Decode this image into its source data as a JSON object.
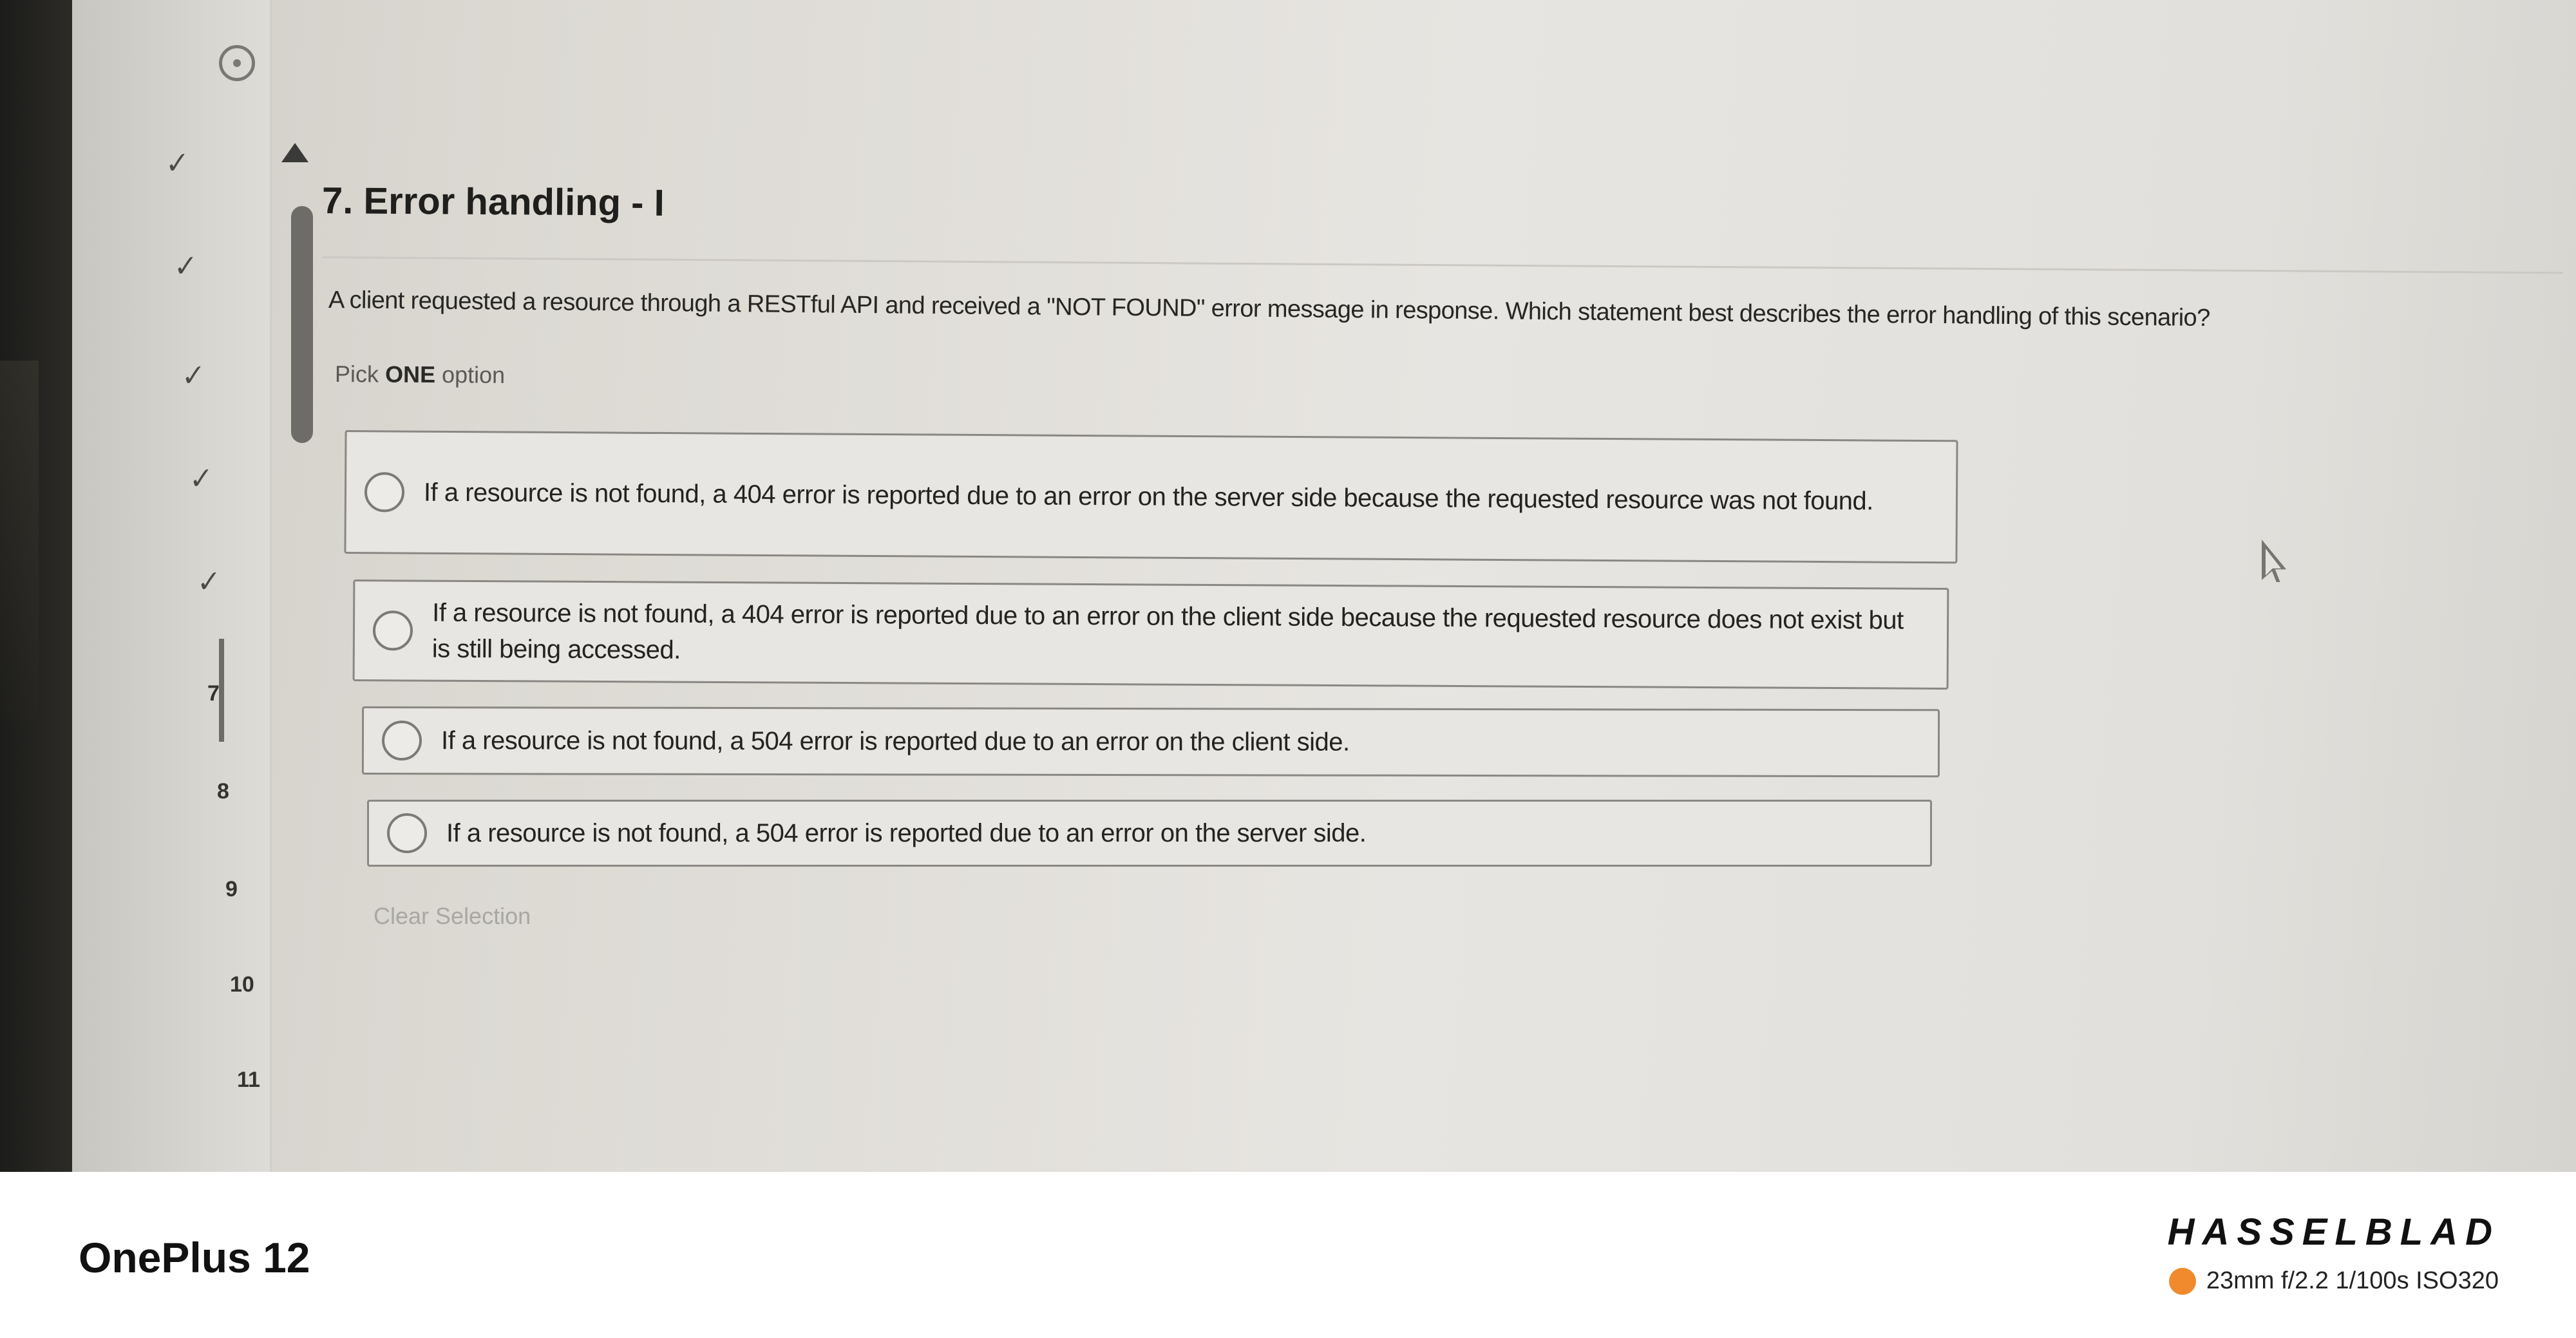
{
  "question": {
    "title": "7. Error handling - I",
    "text": "A client requested a resource through a RESTful API and received a \"NOT FOUND\" error message in response. Which statement best describes the error handling of this scenario?",
    "pick_prefix": "Pick",
    "pick_strong": "ONE",
    "pick_suffix": "option",
    "options": [
      "If a resource is not found, a 404 error is reported due to an error on the server side because the requested resource was not found.",
      "If a resource is not found, a 404 error is reported due to an error on the client side because the requested resource does not exist but is still being accessed.",
      "If a resource is not found, a 504 error is reported due to an error on the client side.",
      "If a resource is not found, a 504 error is reported due to an error on the server side."
    ],
    "clear_label": "Clear Selection"
  },
  "nav": {
    "numbers": [
      "7",
      "8",
      "9",
      "10",
      "11"
    ],
    "check_glyph": "✓",
    "icons": [
      "info-circle-icon",
      "caret-up-icon",
      "check-icon"
    ]
  },
  "watermark": {
    "device": "OnePlus 12",
    "brand": "HASSELBLAD",
    "exif": "23mm  f/2.2  1/100s  ISO320",
    "accent_color": "#f08a2c"
  }
}
